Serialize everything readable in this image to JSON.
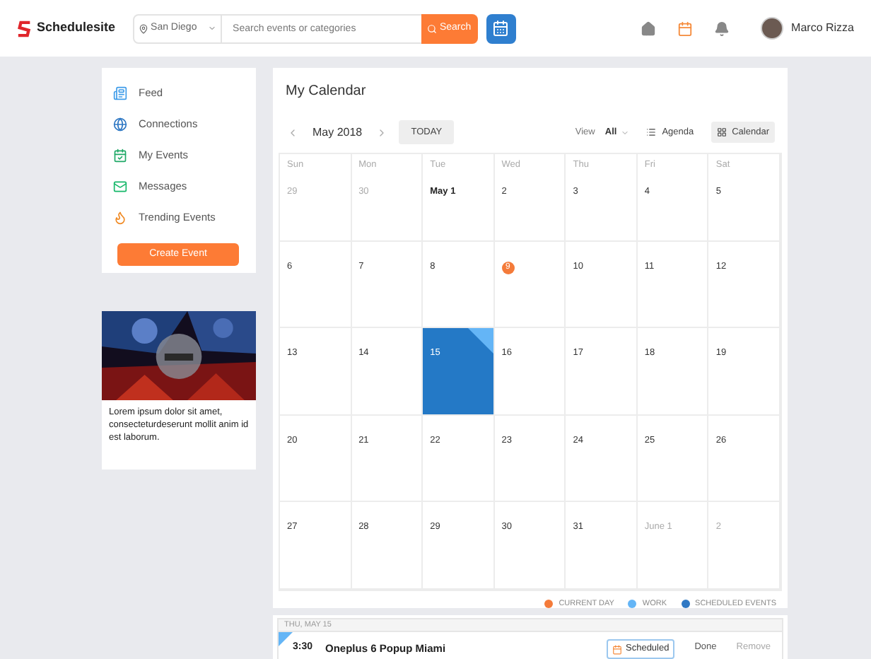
{
  "header": {
    "brand": "Schedulesite",
    "location": "San Diego",
    "search_placeholder": "Search events or categories",
    "search_button": "Search",
    "user_name": "Marco Rizza",
    "nav": [
      {
        "kind": "home",
        "selected": false
      },
      {
        "kind": "calendar",
        "selected": true
      },
      {
        "kind": "bell",
        "selected": false
      }
    ]
  },
  "sidebar": {
    "items": [
      {
        "label": "Feed",
        "kind": "feed"
      },
      {
        "label": "Connections",
        "kind": "globe"
      },
      {
        "label": "My Events",
        "kind": "events"
      },
      {
        "label": "Messages",
        "kind": "mail"
      },
      {
        "label": "Trending Events",
        "kind": "fire"
      }
    ],
    "button": "Create Event"
  },
  "ad": {
    "kind": "picture",
    "text": "Lorem ipsum dolor sit amet, consecteturdeserunt mollit anim id est laborum."
  },
  "calendar": {
    "title": "My Calendar",
    "month": "May 2018",
    "today_button": "TODAY",
    "view_label": "View",
    "view_value": "All",
    "views": [
      {
        "label": "Agenda",
        "selected": false
      },
      {
        "label": "Calendar",
        "selected": true
      }
    ],
    "weekdays": [
      "Sun",
      "Mon",
      "Tue",
      "Wed",
      "Thu",
      "Fri",
      "Sat"
    ],
    "weeks": [
      [
        {
          "label": "29",
          "kind": "muted"
        },
        {
          "label": "30",
          "kind": "muted"
        },
        {
          "label": "May 1",
          "kind": "bold"
        },
        {
          "label": "2",
          "kind": "normal"
        },
        {
          "label": "3",
          "kind": "normal"
        },
        {
          "label": "4",
          "kind": "normal"
        },
        {
          "label": "5",
          "kind": "normal"
        }
      ],
      [
        {
          "label": "6",
          "kind": "normal"
        },
        {
          "label": "7",
          "kind": "normal"
        },
        {
          "label": "8",
          "kind": "normal"
        },
        {
          "label": "9",
          "kind": "today"
        },
        {
          "label": "10",
          "kind": "normal"
        },
        {
          "label": "11",
          "kind": "normal"
        },
        {
          "label": "12",
          "kind": "normal"
        }
      ],
      [
        {
          "label": "13",
          "kind": "normal"
        },
        {
          "label": "14",
          "kind": "normal"
        },
        {
          "label": "15",
          "kind": "event"
        },
        {
          "label": "16",
          "kind": "normal"
        },
        {
          "label": "17",
          "kind": "normal"
        },
        {
          "label": "18",
          "kind": "normal"
        },
        {
          "label": "19",
          "kind": "normal"
        }
      ],
      [
        {
          "label": "20",
          "kind": "normal"
        },
        {
          "label": "21",
          "kind": "normal"
        },
        {
          "label": "22",
          "kind": "normal"
        },
        {
          "label": "23",
          "kind": "normal"
        },
        {
          "label": "24",
          "kind": "normal"
        },
        {
          "label": "25",
          "kind": "normal"
        },
        {
          "label": "26",
          "kind": "normal"
        }
      ],
      [
        {
          "label": "27",
          "kind": "normal"
        },
        {
          "label": "28",
          "kind": "normal"
        },
        {
          "label": "29",
          "kind": "normal"
        },
        {
          "label": "30",
          "kind": "normal"
        },
        {
          "label": "31",
          "kind": "normal"
        },
        {
          "label": "June 1",
          "kind": "muted"
        },
        {
          "label": "2",
          "kind": "muted"
        }
      ]
    ],
    "legend": [
      {
        "label": "CURRENT DAY",
        "color": "#f47b3a"
      },
      {
        "label": "WORK",
        "color": "#64b5f6"
      },
      {
        "label": "SCHEDULED EVENTS",
        "color": "#2f78c4"
      }
    ]
  },
  "agenda": {
    "date": "THU, MAY 15",
    "events": [
      {
        "time": "3:30",
        "title": "Oneplus 6 Popup Miami",
        "status": "Scheduled",
        "actions": [
          "Done",
          "Remove"
        ]
      }
    ]
  }
}
